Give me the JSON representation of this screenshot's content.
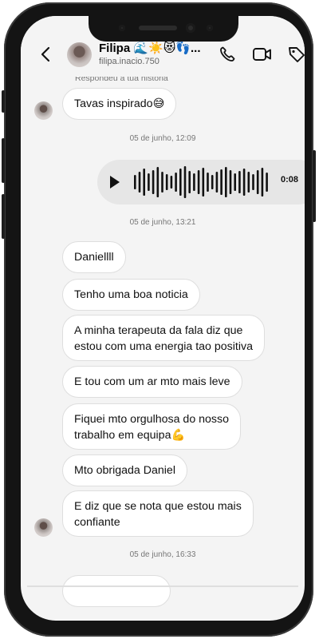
{
  "header": {
    "name": "Filipa 🌊☀️😻👣...",
    "handle": "filipa.inacio.750",
    "icons": [
      "back-icon",
      "phone-icon",
      "video-icon",
      "tag-icon"
    ]
  },
  "story_reply_label": "Respondeu à tua história",
  "messages": {
    "m1": "Tavas inspirado😅",
    "ts1": "05 de junho, 12:09",
    "voice_duration": "0:08",
    "ts2": "05 de junho, 13:21",
    "m2": "Daniellll",
    "m3": "Tenho uma boa noticia",
    "m4_l1": "A minha terapeuta da fala diz que",
    "m4_l2": "estou com uma energia tao positiva",
    "m5": "E tou com um ar mto mais leve",
    "m6_l1": "Fiquei mto orgulhosa do nosso",
    "m6_l2": "trabalho em equipa💪",
    "m7": "Mto obrigada Daniel",
    "m8_l1": "E diz que se nota que estou mais",
    "m8_l2": "confiante",
    "ts3": "05 de junho, 16:33"
  },
  "colors": {
    "screen_bg": "#f4f4f4",
    "bubble_bg": "#ffffff",
    "voice_bg": "#e6e6e6",
    "frame": "#141414"
  }
}
